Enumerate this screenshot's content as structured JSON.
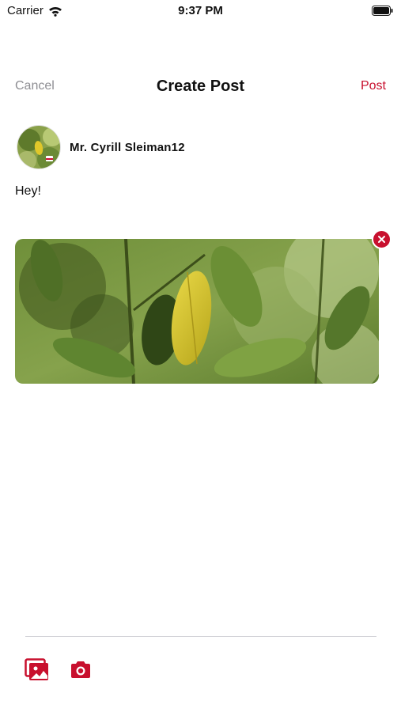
{
  "status_bar": {
    "carrier": "Carrier",
    "time": "9:37 PM"
  },
  "nav": {
    "cancel_label": "Cancel",
    "title": "Create Post",
    "post_label": "Post"
  },
  "author": {
    "name": "Mr. Cyrill Sleiman12"
  },
  "post": {
    "text": "Hey!"
  },
  "toolbar": {
    "icons": [
      "gallery-icon",
      "camera-icon"
    ]
  },
  "colors": {
    "accent": "#c8102e",
    "muted": "#8e8e93",
    "divider": "#d1d1d6"
  }
}
